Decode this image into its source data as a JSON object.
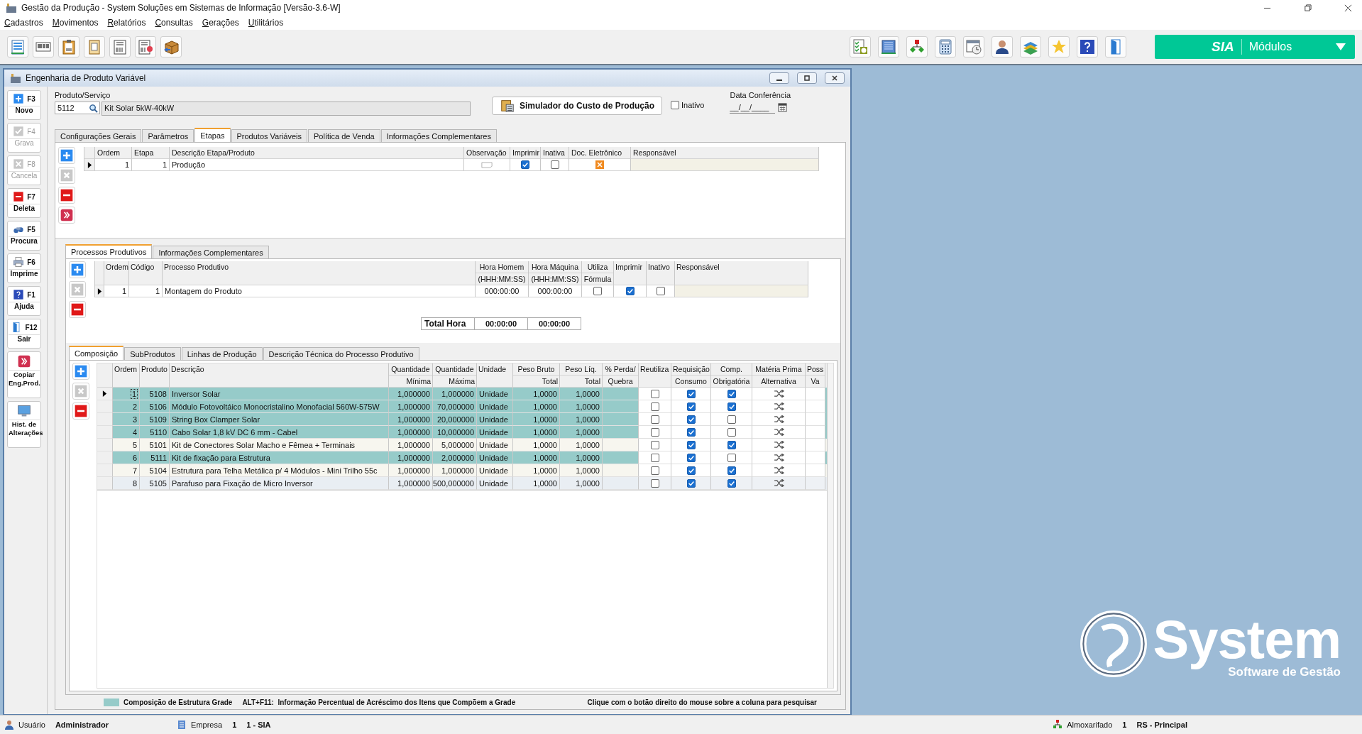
{
  "window": {
    "title": "Gestão da Produção - System Soluções em Sistemas de Informação [Versão-3.6-W]"
  },
  "menu": [
    "Cadastros",
    "Movimentos",
    "Relatórios",
    "Consultas",
    "Gerações",
    "Utilitários"
  ],
  "modules_button": {
    "brand": "SIA",
    "label": "Módulos"
  },
  "form": {
    "title": "Engenharia de Produto Variável",
    "sidebar": [
      {
        "kind": "fkey",
        "key": "F3",
        "label": "Novo",
        "disabled": false
      },
      {
        "kind": "fkey",
        "key": "F4",
        "label": "Grava",
        "disabled": true
      },
      {
        "kind": "fkey",
        "key": "F8",
        "label": "Cancela",
        "disabled": true
      },
      {
        "kind": "fkey",
        "key": "F7",
        "label": "Deleta",
        "disabled": false
      },
      {
        "kind": "fkey",
        "key": "F5",
        "label": "Procura",
        "disabled": false
      },
      {
        "kind": "fkey",
        "key": "F6",
        "label": "Imprime",
        "disabled": false
      },
      {
        "kind": "fkey",
        "key": "F1",
        "label": "Ajuda",
        "disabled": false
      },
      {
        "kind": "fkey",
        "key": "F12",
        "label": "Sair",
        "disabled": false
      },
      {
        "kind": "action",
        "label": "Copiar Eng.Prod.",
        "disabled": false
      },
      {
        "kind": "action",
        "label": "Hist. de Alterações",
        "disabled": false
      }
    ],
    "product": {
      "label": "Produto/Serviço",
      "code": "5112",
      "name": "Kit Solar 5kW-40kW"
    },
    "simulator_button": "Simulador do Custo de Produção",
    "inactive": {
      "label": "Inativo",
      "checked": false
    },
    "date": {
      "label": "Data Conferência",
      "value": "__/__/____"
    },
    "tabs": [
      {
        "label": "Configurações Gerais",
        "selected": false
      },
      {
        "label": "Parâmetros",
        "selected": false
      },
      {
        "label": "Etapas",
        "selected": true
      },
      {
        "label": "Produtos Variáveis",
        "selected": false
      },
      {
        "label": "Política de Venda",
        "selected": false
      },
      {
        "label": "Informações Complementares",
        "selected": false
      }
    ],
    "stages": {
      "columns": [
        "Ordem",
        "Etapa",
        "Descrição Etapa/Produto",
        "Observação",
        "Imprimir",
        "Inativa",
        "Doc. Eletrônico",
        "Responsável"
      ],
      "rows": [
        {
          "ordem": "1",
          "etapa": "1",
          "descricao": "Produção",
          "imprimir": true,
          "inativa": false,
          "selected": true
        }
      ]
    },
    "processes": {
      "tabs": [
        {
          "label": "Processos Produtivos",
          "selected": true
        },
        {
          "label": "Informações Complementares",
          "selected": false
        }
      ],
      "columns": [
        {
          "top": "Ordem"
        },
        {
          "top": "Código"
        },
        {
          "top": "Processo Produtivo"
        },
        {
          "top": "Hora Homem",
          "bottom": "(HHH:MM:SS)"
        },
        {
          "top": "Hora Máquina",
          "bottom": "(HHH:MM:SS)"
        },
        {
          "top": "Utiliza",
          "bottom": "Fórmula"
        },
        {
          "top": "Imprimir"
        },
        {
          "top": "Inativo"
        },
        {
          "top": "Responsável"
        }
      ],
      "rows": [
        {
          "ordem": "1",
          "codigo": "1",
          "processo": "Montagem do Produto",
          "hora_homem": "000:00:00",
          "hora_maquina": "000:00:00",
          "utiliza_formula": false,
          "imprimir": true,
          "inativo": false,
          "selected": true
        }
      ],
      "total": {
        "label": "Total Hora",
        "hora_homem": "00:00:00",
        "hora_maquina": "00:00:00"
      }
    },
    "composition": {
      "tabs": [
        {
          "label": "Composição",
          "selected": true
        },
        {
          "label": "SubProdutos",
          "selected": false
        },
        {
          "label": "Linhas de Produção",
          "selected": false
        },
        {
          "label": "Descrição Técnica do Processo Produtivo",
          "selected": false
        }
      ],
      "columns": [
        {
          "top": "Ordem"
        },
        {
          "top": "Produto"
        },
        {
          "top": "Descrição"
        },
        {
          "top": "Quantidade",
          "bottom": "Mínima"
        },
        {
          "top": "Quantidade",
          "bottom": "Máxima"
        },
        {
          "top": "Unidade"
        },
        {
          "top": "Peso Bruto",
          "bottom": "Total"
        },
        {
          "top": "Peso Líq.",
          "bottom": "Total"
        },
        {
          "top": "% Perda/",
          "bottom": "Quebra"
        },
        {
          "top": "Reutiliza"
        },
        {
          "top": "Requisição",
          "bottom": "Consumo"
        },
        {
          "top": "Comp.",
          "bottom": "Obrigatória"
        },
        {
          "top": "Matéria Prima",
          "bottom": "Alternativa"
        },
        {
          "top": "Poss",
          "bottom": "Va"
        }
      ],
      "rows": [
        {
          "ordem": "1",
          "produto": "5108",
          "descricao": "Inversor Solar",
          "qtd_min": "1,000000",
          "qtd_max": "1,000000",
          "unidade": "Unidade",
          "peso_bruto": "1,0000",
          "peso_liq": "1,0000",
          "reutiliza": false,
          "consumo": true,
          "obrigatoria": true,
          "grade": true,
          "selected": true
        },
        {
          "ordem": "2",
          "produto": "5106",
          "descricao": "Módulo Fotovoltáico Monocristalino Monofacial 560W-575W",
          "qtd_min": "1,000000",
          "qtd_max": "70,000000",
          "unidade": "Unidade",
          "peso_bruto": "1,0000",
          "peso_liq": "1,0000",
          "reutiliza": false,
          "consumo": true,
          "obrigatoria": true,
          "grade": true,
          "selected": false
        },
        {
          "ordem": "3",
          "produto": "5109",
          "descricao": "String Box Clamper Solar",
          "qtd_min": "1,000000",
          "qtd_max": "20,000000",
          "unidade": "Unidade",
          "peso_bruto": "1,0000",
          "peso_liq": "1,0000",
          "reutiliza": false,
          "consumo": true,
          "obrigatoria": false,
          "grade": true,
          "selected": false
        },
        {
          "ordem": "4",
          "produto": "5110",
          "descricao": "Cabo Solar 1,8 kV DC 6 mm - Cabel",
          "qtd_min": "1,000000",
          "qtd_max": "10,000000",
          "unidade": "Unidade",
          "peso_bruto": "1,0000",
          "peso_liq": "1,0000",
          "reutiliza": false,
          "consumo": true,
          "obrigatoria": false,
          "grade": true,
          "selected": false
        },
        {
          "ordem": "5",
          "produto": "5101",
          "descricao": "Kit de Conectores Solar Macho e Fêmea + Terminais",
          "qtd_min": "1,000000",
          "qtd_max": "5,000000",
          "unidade": "Unidade",
          "peso_bruto": "1,0000",
          "peso_liq": "1,0000",
          "reutiliza": false,
          "consumo": true,
          "obrigatoria": true,
          "grade": false,
          "selected": false
        },
        {
          "ordem": "6",
          "produto": "5111",
          "descricao": "Kit de fixação para Estrutura",
          "qtd_min": "1,000000",
          "qtd_max": "2,000000",
          "unidade": "Unidade",
          "peso_bruto": "1,0000",
          "peso_liq": "1,0000",
          "reutiliza": false,
          "consumo": true,
          "obrigatoria": false,
          "grade": true,
          "selected": false
        },
        {
          "ordem": "7",
          "produto": "5104",
          "descricao": "Estrutura para Telha Metálica p/ 4 Módulos - Mini Trilho 55c",
          "qtd_min": "1,000000",
          "qtd_max": "1,000000",
          "unidade": "Unidade",
          "peso_bruto": "1,0000",
          "peso_liq": "1,0000",
          "reutiliza": false,
          "consumo": true,
          "obrigatoria": true,
          "grade": false,
          "selected": false
        },
        {
          "ordem": "8",
          "produto": "5105",
          "descricao": "Parafuso para Fixação de Micro Inversor",
          "qtd_min": "1,000000",
          "qtd_max": "500,000000",
          "unidade": "Unidade",
          "peso_bruto": "1,0000",
          "peso_liq": "1,0000",
          "reutiliza": false,
          "consumo": true,
          "obrigatoria": true,
          "grade": false,
          "selected": false
        }
      ]
    },
    "legend": {
      "grade_label": "Composição de Estrutura Grade",
      "shortcut": "ALT+F11:  Informação Percentual de Acréscimo dos Itens que Compõem a Grade",
      "hint": "Clique com o botão direito do mouse sobre a coluna para pesquisar"
    }
  },
  "status_bar": {
    "user_label": "Usuário",
    "user": "Administrador",
    "company_label": "Empresa",
    "company_code": "1",
    "company": "1 - SIA",
    "warehouse_label": "Almoxarifado",
    "warehouse_code": "1",
    "warehouse": "RS - Principal"
  },
  "logo": {
    "name": "System",
    "tagline": "Software de Gestão"
  }
}
